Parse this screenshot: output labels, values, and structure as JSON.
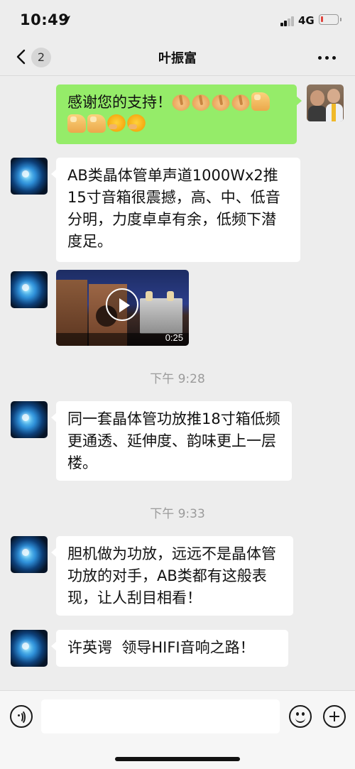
{
  "status_bar": {
    "time": "10:49",
    "network": "4G",
    "battery_color": "#e0443e"
  },
  "nav": {
    "back_count": "2",
    "title": "叶振富"
  },
  "messages": [
    {
      "type": "text",
      "sender": "self",
      "text": "感谢您的支持！",
      "emojis_line1": [
        "hands",
        "hands",
        "hands",
        "hands",
        "thumb"
      ],
      "emojis_line2": [
        "thumb",
        "thumb",
        "hug",
        "hug"
      ]
    },
    {
      "type": "text",
      "sender": "other",
      "text": "AB类晶体管单声道1000Wx2推15寸音箱很震撼，高、中、低音分明，力度卓卓有余，低频下潜度足。"
    },
    {
      "type": "video",
      "sender": "other",
      "duration": "0:25"
    },
    {
      "type": "time",
      "text": "下午 9:28"
    },
    {
      "type": "text",
      "sender": "other",
      "text": "同一套晶体管功放推18寸箱低频更通透、延伸度、韵味更上一层楼。"
    },
    {
      "type": "time",
      "text": "下午 9:33"
    },
    {
      "type": "text",
      "sender": "other",
      "text": "胆机做为功放，远远不是晶体管功放的对手，AB类都有这般表现，让人刮目相看！"
    },
    {
      "type": "text",
      "sender": "other",
      "text": "许英谔  领导HIFI音响之路！"
    }
  ],
  "input": {
    "placeholder": ""
  },
  "colors": {
    "background": "#ededed",
    "bubble_out": "#95ec69",
    "bubble_in": "#ffffff"
  }
}
